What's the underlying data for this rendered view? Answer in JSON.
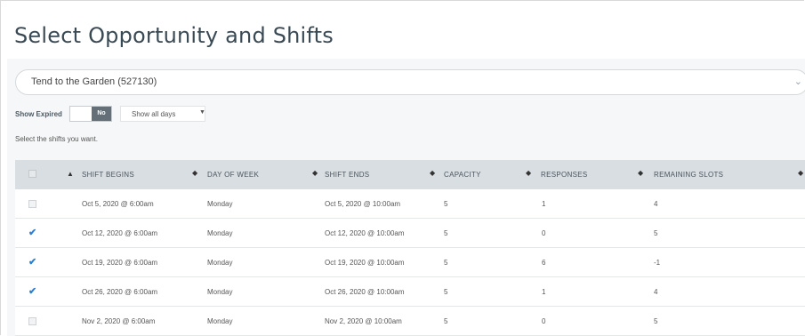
{
  "page_title": "Select Opportunity and Shifts",
  "opportunity_select": {
    "value": "Tend to the Garden (527130)"
  },
  "show_expired": {
    "label": "Show Expired",
    "toggle_value": "No"
  },
  "days_filter": {
    "value": "Show all days"
  },
  "hint": "Select the shifts you want.",
  "table": {
    "columns": [
      "SHIFT BEGINS",
      "DAY OF WEEK",
      "SHIFT ENDS",
      "CAPACITY",
      "RESPONSES",
      "REMAINING SLOTS"
    ],
    "rows": [
      {
        "checked": false,
        "disabled": true,
        "shift_begins": "Oct 5, 2020 @ 6:00am",
        "day": "Monday",
        "shift_ends": "Oct 5, 2020 @ 10:00am",
        "capacity": "5",
        "responses": "1",
        "remaining": "4"
      },
      {
        "checked": true,
        "disabled": false,
        "shift_begins": "Oct 12, 2020 @ 6:00am",
        "day": "Monday",
        "shift_ends": "Oct 12, 2020 @ 10:00am",
        "capacity": "5",
        "responses": "0",
        "remaining": "5"
      },
      {
        "checked": true,
        "disabled": false,
        "shift_begins": "Oct 19, 2020 @ 6:00am",
        "day": "Monday",
        "shift_ends": "Oct 19, 2020 @ 10:00am",
        "capacity": "5",
        "responses": "6",
        "remaining": "-1"
      },
      {
        "checked": true,
        "disabled": false,
        "shift_begins": "Oct 26, 2020 @ 6:00am",
        "day": "Monday",
        "shift_ends": "Oct 26, 2020 @ 10:00am",
        "capacity": "5",
        "responses": "1",
        "remaining": "4"
      },
      {
        "checked": false,
        "disabled": true,
        "shift_begins": "Nov 2, 2020 @ 6:00am",
        "day": "Monday",
        "shift_ends": "Nov 2, 2020 @ 10:00am",
        "capacity": "5",
        "responses": "0",
        "remaining": "5"
      }
    ]
  },
  "colors": {
    "accent": "#2d7fcf",
    "header_bg": "#d9dee2",
    "panel_bg": "#f6f7f8",
    "toggle_on": "#646f78"
  }
}
